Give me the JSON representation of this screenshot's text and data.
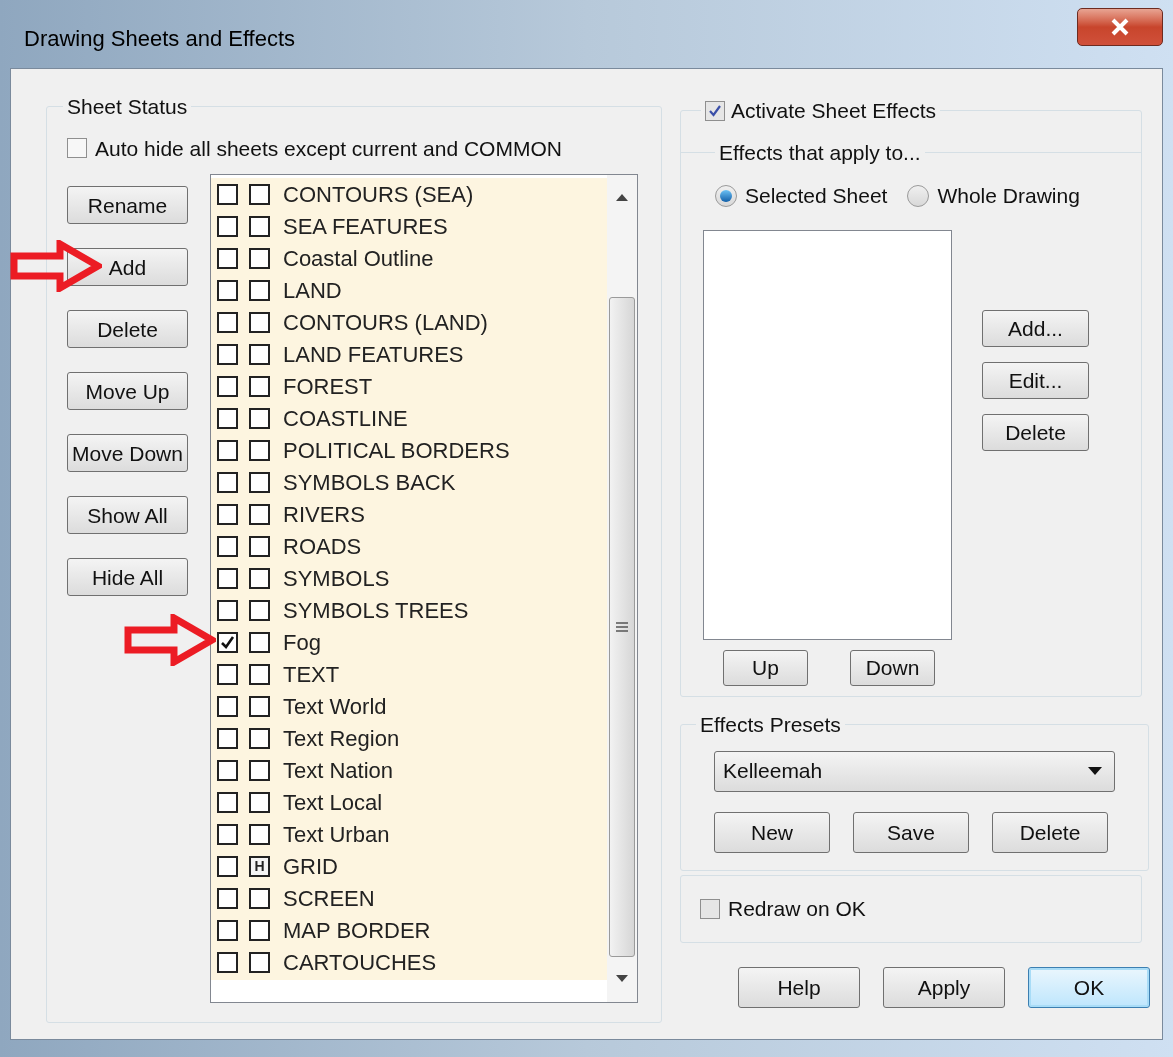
{
  "window": {
    "title": "Drawing Sheets and Effects"
  },
  "sheet_status": {
    "title": "Sheet Status",
    "auto_hide": {
      "label": "Auto hide all sheets except current and COMMON",
      "checked": false
    },
    "hidden_mark": "H",
    "buttons": [
      "Rename",
      "Add",
      "Delete",
      "Move Up",
      "Move Down",
      "Show All",
      "Hide All"
    ],
    "sheets": [
      {
        "name": "CONTOURS (SEA)",
        "checked": false,
        "hidden": false
      },
      {
        "name": "SEA FEATURES",
        "checked": false,
        "hidden": false
      },
      {
        "name": "Coastal Outline",
        "checked": false,
        "hidden": false
      },
      {
        "name": "LAND",
        "checked": false,
        "hidden": false
      },
      {
        "name": "CONTOURS (LAND)",
        "checked": false,
        "hidden": false
      },
      {
        "name": "LAND FEATURES",
        "checked": false,
        "hidden": false
      },
      {
        "name": "FOREST",
        "checked": false,
        "hidden": false
      },
      {
        "name": "COASTLINE",
        "checked": false,
        "hidden": false
      },
      {
        "name": "POLITICAL BORDERS",
        "checked": false,
        "hidden": false
      },
      {
        "name": "SYMBOLS BACK",
        "checked": false,
        "hidden": false
      },
      {
        "name": "RIVERS",
        "checked": false,
        "hidden": false
      },
      {
        "name": "ROADS",
        "checked": false,
        "hidden": false
      },
      {
        "name": "SYMBOLS",
        "checked": false,
        "hidden": false
      },
      {
        "name": "SYMBOLS TREES",
        "checked": false,
        "hidden": false
      },
      {
        "name": "Fog",
        "checked": true,
        "hidden": false
      },
      {
        "name": "TEXT",
        "checked": false,
        "hidden": false
      },
      {
        "name": "Text World",
        "checked": false,
        "hidden": false
      },
      {
        "name": "Text Region",
        "checked": false,
        "hidden": false
      },
      {
        "name": "Text Nation",
        "checked": false,
        "hidden": false
      },
      {
        "name": "Text Local",
        "checked": false,
        "hidden": false
      },
      {
        "name": "Text Urban",
        "checked": false,
        "hidden": false
      },
      {
        "name": "GRID",
        "checked": false,
        "hidden": true
      },
      {
        "name": "SCREEN",
        "checked": false,
        "hidden": false
      },
      {
        "name": "MAP BORDER",
        "checked": false,
        "hidden": false
      },
      {
        "name": "CARTOUCHES",
        "checked": false,
        "hidden": false
      }
    ]
  },
  "effects": {
    "activate": {
      "label": "Activate Sheet Effects",
      "checked": true
    },
    "apply_to": {
      "title": "Effects that apply to...",
      "options": [
        {
          "label": "Selected Sheet",
          "selected": true
        },
        {
          "label": "Whole Drawing",
          "selected": false
        }
      ]
    },
    "side_buttons": [
      "Add...",
      "Edit...",
      "Delete"
    ],
    "order_buttons": [
      "Up",
      "Down"
    ]
  },
  "presets": {
    "title": "Effects Presets",
    "value": "Kelleemah",
    "buttons": [
      "New",
      "Save",
      "Delete"
    ]
  },
  "redraw": {
    "label": "Redraw on OK",
    "checked": false
  },
  "footer_buttons": [
    {
      "label": "Help",
      "default": false
    },
    {
      "label": "Apply",
      "default": false
    },
    {
      "label": "OK",
      "default": true
    }
  ]
}
